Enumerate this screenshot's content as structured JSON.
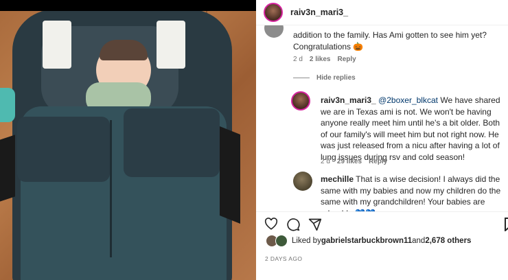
{
  "post": {
    "username": "raiv3n_mari3_",
    "likes_prefix": "Liked by ",
    "likes_user": "gabrielstarbuckbrown11",
    "likes_mid": " and ",
    "likes_count": "2,678 others",
    "date": "2 DAYS AGO"
  },
  "comments": {
    "c1": {
      "text_line1": "addition to the family. Has Ami gotten to see him yet?",
      "text_line2": "Congratulations",
      "emoji": "🎃",
      "time": "2 d",
      "likes": "2 likes",
      "reply": "Reply"
    },
    "hide_replies": "Hide replies",
    "c2": {
      "author": "raiv3n_mari3_",
      "mention": "@2boxer_blkcat",
      "text": "We have shared we are in Texas ami is not. We won't be having anyone really meet him until he's a bit older. Both of our family's will meet him but not right now. He was just released from a nicu after having a lot of lung issues during rsv and cold season!",
      "time": "2 d",
      "likes": "29 likes",
      "reply": "Reply"
    },
    "c3": {
      "author": "mechille",
      "text": "That is a wise decision! I always did the same with my babies and now my children do the same with my grandchildren! Your babies are adorable",
      "emoji": "💙💙"
    }
  }
}
